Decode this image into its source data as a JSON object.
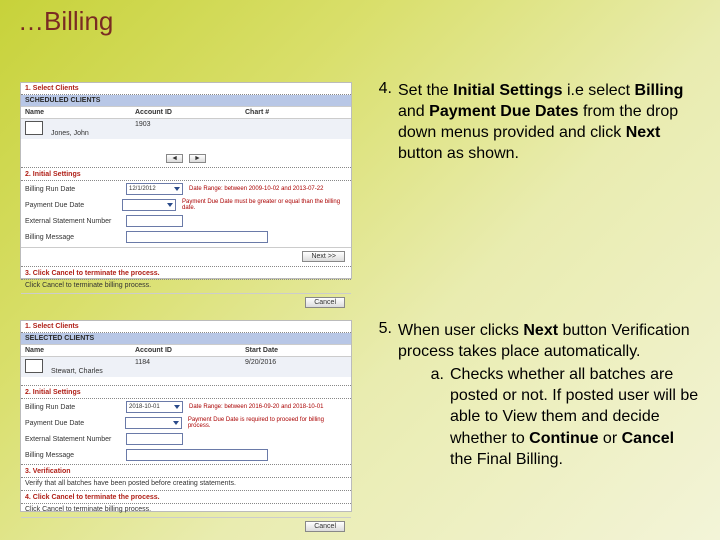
{
  "title": "…Billing",
  "steps": {
    "s4": {
      "num": "4.",
      "pre": "Set the ",
      "b1": "Initial Settings",
      "mid1": " i.e select ",
      "b2": "Billing",
      "mid2": " and ",
      "b3": "Payment Due Dates",
      "mid3": " from the drop down menus provided and click ",
      "b4": "Next",
      "post": " button as shown."
    },
    "s5": {
      "num": "5.",
      "pre": "When user clicks ",
      "b1": "Next",
      "post": " button Verification process takes place automatically.",
      "sub": {
        "num": "a.",
        "t1": "Checks whether all batches are posted or not. If posted user will be able to View them and decide whether to ",
        "b1": "Continue",
        "t2": " or ",
        "b2": "Cancel",
        "t3": " the Final Billing."
      }
    }
  },
  "shot1": {
    "sect1": "1. Select Clients",
    "bar": "SCHEDULED CLIENTS",
    "h_name": "Name",
    "h_acct": "Account ID",
    "h_chart": "Chart #",
    "r_name": "Jones, John",
    "r_acct": "1903",
    "r_chart": "",
    "sect2": "2. Initial Settings",
    "f_bill": "Billing Run Date",
    "f_bill_val": "12/1/2012",
    "f_pay": "Payment Due Date",
    "f_pay_val": "",
    "hint_range": "Date Range: between 2009-10-02 and 2013-07-22",
    "hint_pay": "Payment Due Date must be greater or equal than the billing date.",
    "f_ext": "External Statement Number",
    "f_msg": "Billing Message",
    "sect3": "3. Click Cancel to terminate the process.",
    "foot": "Click Cancel to terminate billing process.",
    "btn_next": "Next >>",
    "btn_cancel": "Cancel"
  },
  "shot2": {
    "sect1": "1. Select Clients",
    "bar": "SELECTED CLIENTS",
    "h_name": "Name",
    "h_acct": "Account ID",
    "h_date": "Start Date",
    "r_name": "Stewart, Charles",
    "r_acct": "1184",
    "r_date": "9/20/2016",
    "sect2": "2. Initial Settings",
    "f_bill": "Billing Run Date",
    "f_bill_val": "2018-10-01",
    "hint_range": "Date Range: between 2016-09-20 and 2018-10-01",
    "f_pay": "Payment Due Date",
    "hint_pay": "Payment Due Date is required to proceed for billing process.",
    "f_ext": "External Statement Number",
    "f_msg": "Billing Message",
    "sect3": "3. Verification",
    "verify": "Verify that all batches have been posted before creating statements.",
    "sect4": "4. Click Cancel to terminate the process.",
    "foot": "Click Cancel to terminate billing process.",
    "btn_cancel": "Cancel"
  }
}
